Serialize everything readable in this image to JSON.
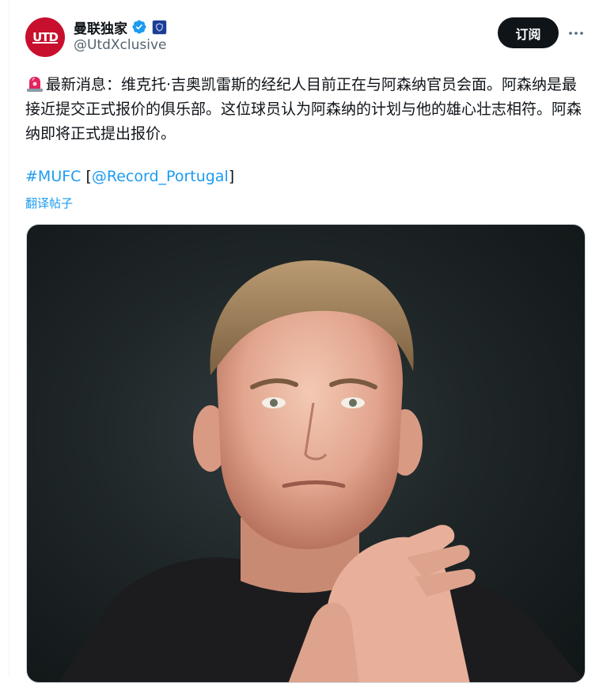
{
  "account": {
    "display_name": "曼联独家",
    "handle": "@UtdXclusive",
    "avatar_text": "UTD"
  },
  "actions": {
    "subscribe_label": "订阅"
  },
  "tweet": {
    "text": "最新消息：维克托·吉奥凯雷斯的经纪人目前正在与阿森纳官员会面。阿森纳是最接近提交正式报价的俱乐部。这位球员认为阿森纳的计划与他的雄心壮志相符。阿森纳即将正式提出报价。",
    "hashtag": "#MUFC",
    "bracket_open": "[",
    "mention": "@Record_Portugal",
    "bracket_close": "]",
    "translate_label": "翻译帖子"
  },
  "colors": {
    "link": "#1d9bf0",
    "text": "#0f1419",
    "secondary": "#536471",
    "verified": "#1d9bf0",
    "avatar_bg": "#c8102e",
    "button_bg": "#0f1419"
  },
  "icons": {
    "verified": "verified-badge-icon",
    "affiliate": "affiliate-badge-icon",
    "more": "more-horizontal-icon",
    "siren": "rotating-light-emoji-icon"
  }
}
